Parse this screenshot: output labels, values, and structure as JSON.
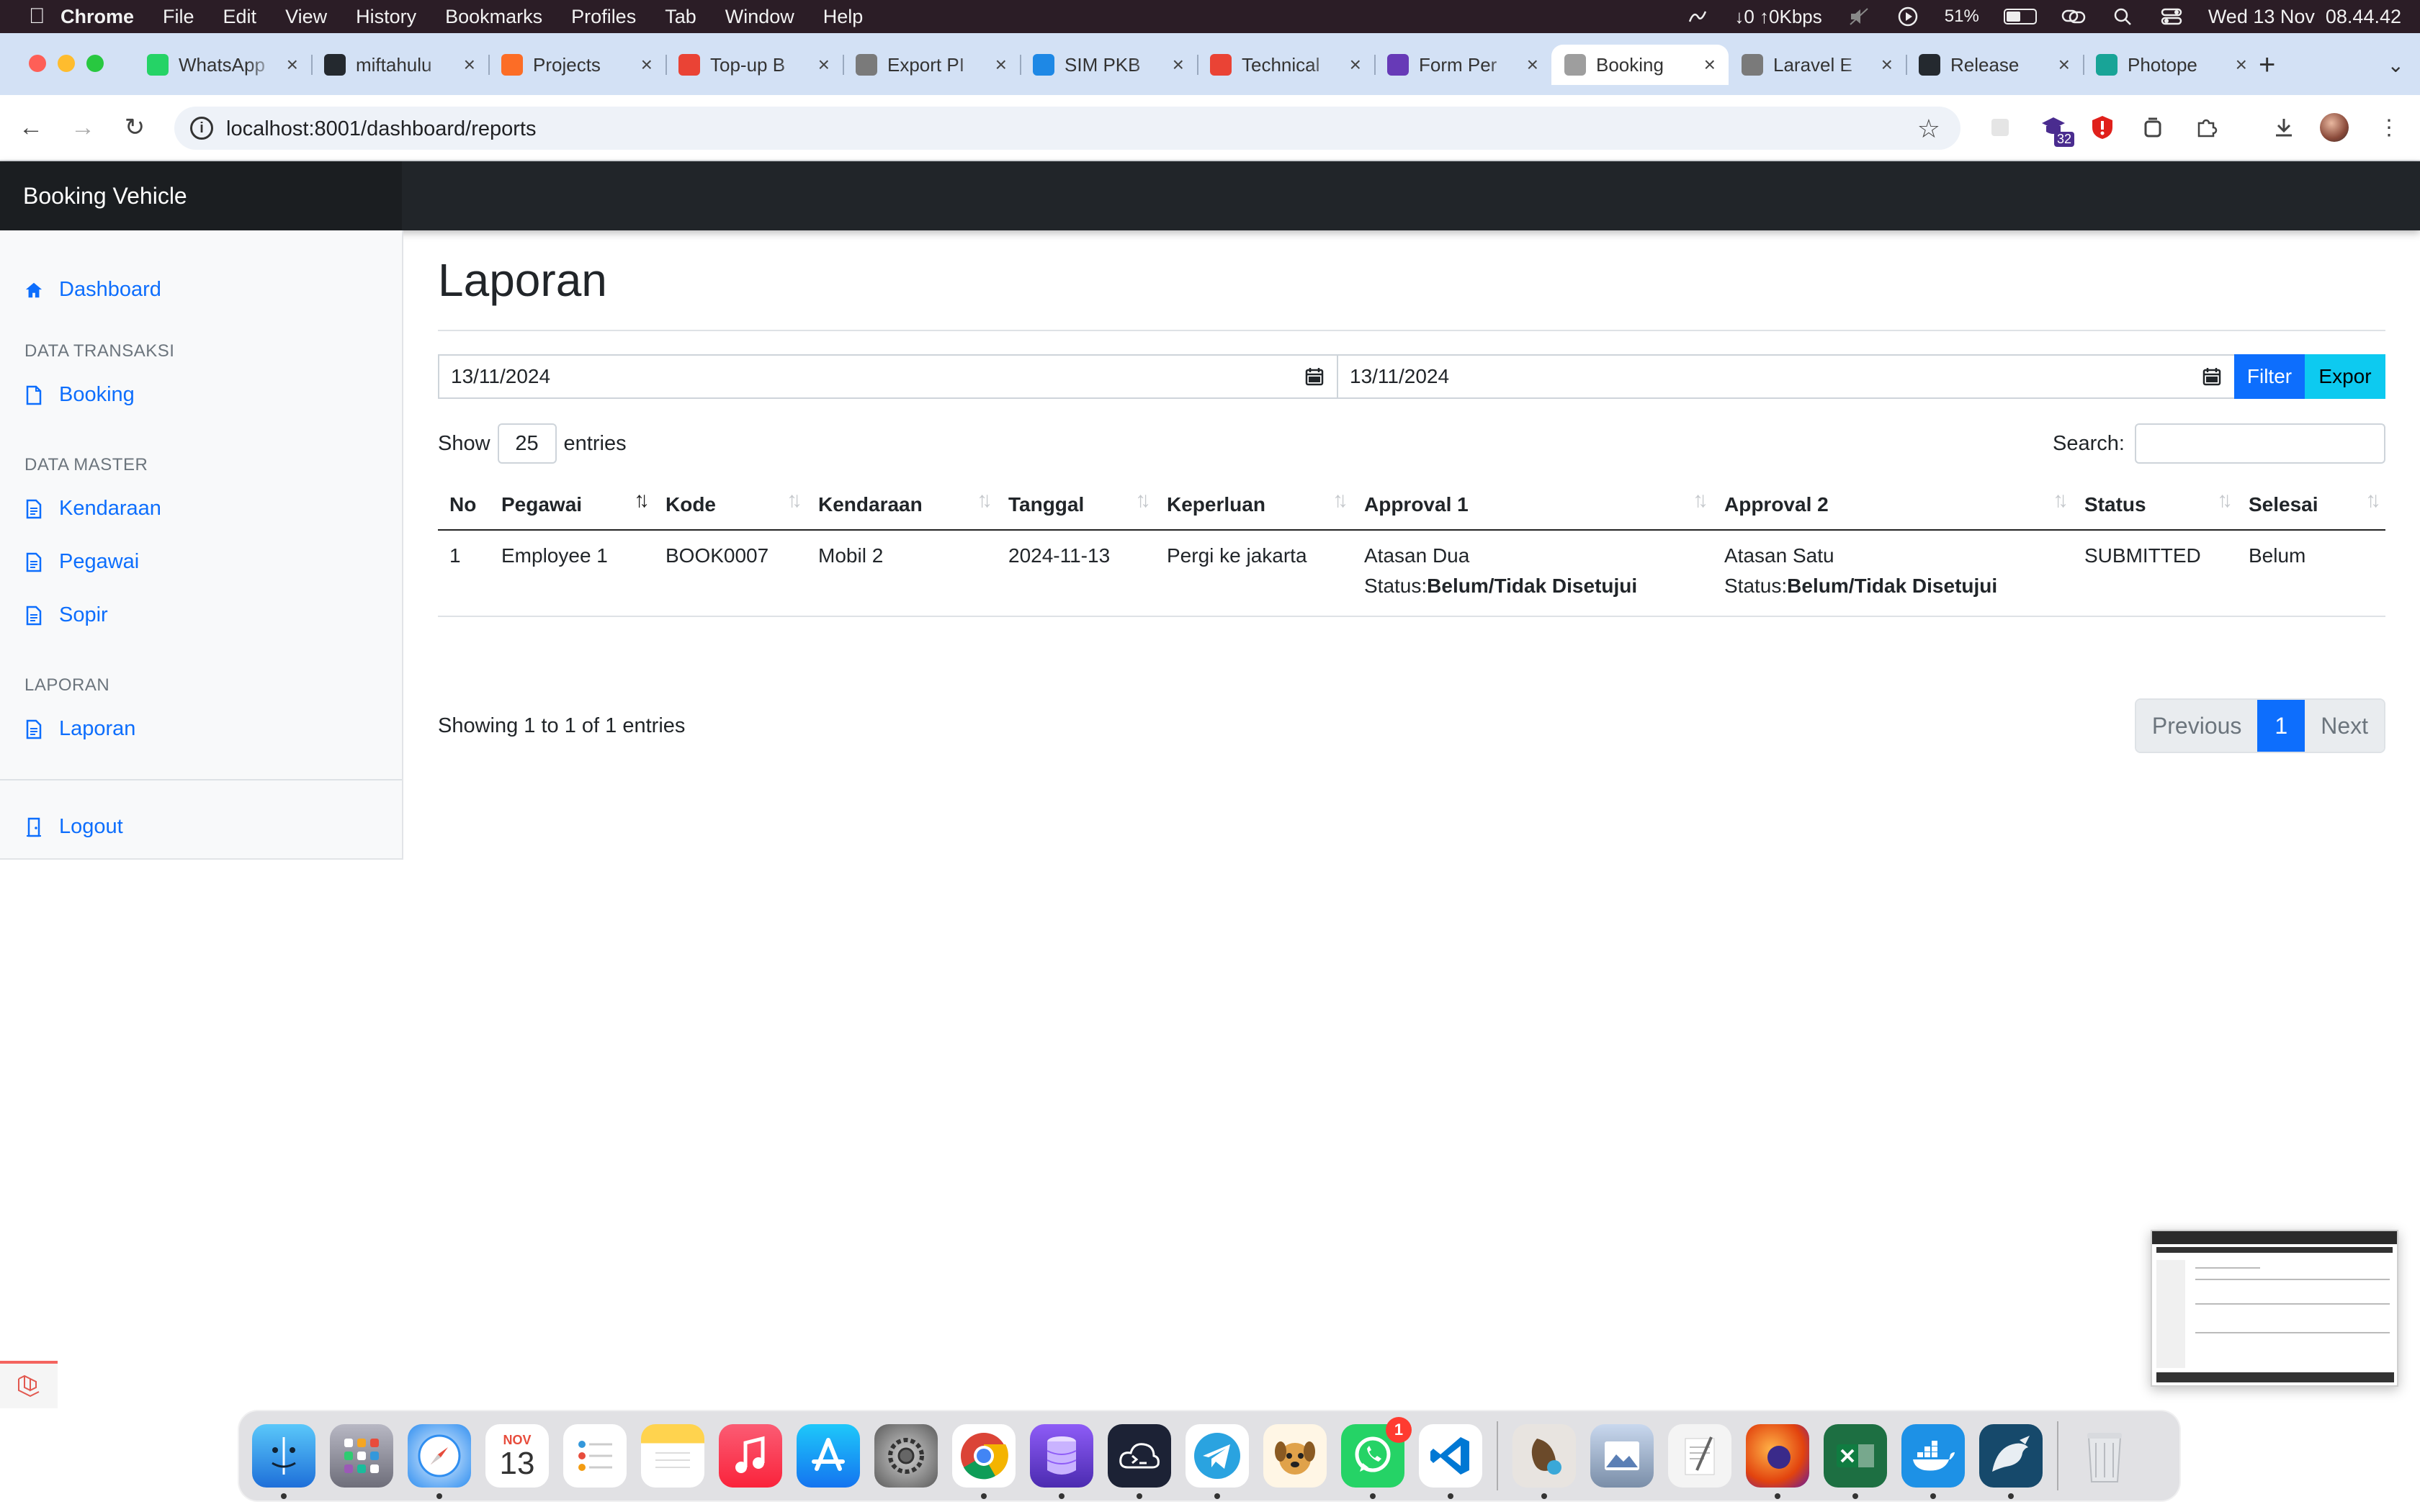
{
  "menubar": {
    "app_name": "Chrome",
    "items": [
      "File",
      "Edit",
      "View",
      "History",
      "Bookmarks",
      "Profiles",
      "Tab",
      "Window",
      "Help"
    ],
    "network": "↓0 ↑0Kbps",
    "battery_percent": "51%",
    "battery_level": 0.51,
    "datetime": "Wed 13 Nov  08.44.42"
  },
  "browser": {
    "tabs": [
      {
        "title": "WhatsApp",
        "color": "#25d366"
      },
      {
        "title": "miftahulu",
        "color": "#24292f"
      },
      {
        "title": "Projects",
        "color": "#fc6d26"
      },
      {
        "title": "Top-up B",
        "color": "#ea4335"
      },
      {
        "title": "Export PI",
        "color": "#7a7a7a"
      },
      {
        "title": "SIM PKB",
        "color": "#1e88e5"
      },
      {
        "title": "Technical",
        "color": "#ea4335"
      },
      {
        "title": "Form Per",
        "color": "#673ab7"
      },
      {
        "title": "Booking",
        "color": "#9e9e9e",
        "active": true
      },
      {
        "title": "Laravel E",
        "color": "#7a7a7a"
      },
      {
        "title": "Release",
        "color": "#24292f"
      },
      {
        "title": "Photope",
        "color": "#18a497"
      }
    ],
    "url": "localhost:8001/dashboard/reports",
    "extension_badge": "32"
  },
  "app": {
    "brand": "Booking Vehicle",
    "sidebar": {
      "dashboard": "Dashboard",
      "heading_transaksi": "DATA TRANSAKSI",
      "booking": "Booking",
      "heading_master": "DATA MASTER",
      "kendaraan": "Kendaraan",
      "pegawai": "Pegawai",
      "sopir": "Sopir",
      "heading_laporan": "LAPORAN",
      "laporan": "Laporan",
      "logout": "Logout"
    },
    "main": {
      "title": "Laporan",
      "date_from": "13/11/2024",
      "date_to": "13/11/2024",
      "filter_label": "Filter",
      "export_label": "Expor",
      "show_label": "Show",
      "entries_value": "25",
      "entries_label": "entries",
      "search_label": "Search:",
      "search_value": "",
      "columns": [
        "No",
        "Pegawai",
        "Kode",
        "Kendaraan",
        "Tanggal",
        "Keperluan",
        "Approval 1",
        "Approval 2",
        "Status",
        "Selesai"
      ],
      "rows": [
        {
          "no": "1",
          "pegawai": "Employee 1",
          "kode": "BOOK0007",
          "kendaraan": "Mobil 2",
          "tanggal": "2024-11-13",
          "keperluan": "Pergi ke jakarta",
          "approval1_name": "Atasan Dua",
          "approval1_prefix": "Status:",
          "approval1_status": "Belum/Tidak Disetujui",
          "approval2_name": "Atasan Satu",
          "approval2_prefix": "Status:",
          "approval2_status": "Belum/Tidak Disetujui",
          "status": "SUBMITTED",
          "selesai": "Belum"
        }
      ],
      "info": "Showing 1 to 1 of 1 entries",
      "pagination": {
        "previous": "Previous",
        "current": "1",
        "next": "Next"
      }
    }
  },
  "dock": {
    "calendar_month": "NOV",
    "calendar_day": "13",
    "whatsapp_badge": "1"
  }
}
